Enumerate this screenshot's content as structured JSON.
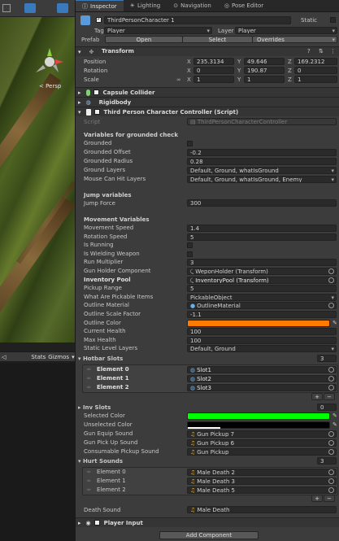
{
  "scene": {
    "stats": "Stats",
    "gizmos": "Gizmos",
    "persp": "< Persp"
  },
  "tabs": [
    "Inspector",
    "Lighting",
    "Navigation",
    "Pose Editor"
  ],
  "header": {
    "name": "ThirdPersonCharacter 1",
    "static": "Static",
    "tag_label": "Tag",
    "tag": "Player",
    "layer_label": "Layer",
    "layer": "Player",
    "prefab_label": "Prefab",
    "open": "Open",
    "select": "Select",
    "overrides": "Overrides"
  },
  "transform": {
    "title": "Transform",
    "position_label": "Position",
    "rotation_label": "Rotation",
    "scale_label": "Scale",
    "position": [
      "235.3134",
      "49.646",
      "169.2312"
    ],
    "rotation": [
      "0",
      "190.87",
      "0"
    ],
    "scale": [
      "1",
      "1",
      "1"
    ],
    "axes": [
      "X",
      "Y",
      "Z"
    ]
  },
  "components": {
    "capsule": "Capsule Collider",
    "rigidbody": "Rigidbody",
    "controller": "Third Person Character Controller (Script)",
    "player_input": "Player Input"
  },
  "script": {
    "label": "Script",
    "value": "ThirdPersonCharacterController"
  },
  "grounded": {
    "header": "Variables for grounded check",
    "rows": [
      {
        "label": "Grounded",
        "value": ""
      },
      {
        "label": "Grounded Offset",
        "value": "-0.2"
      },
      {
        "label": "Grounded Radius",
        "value": "0.28"
      },
      {
        "label": "Ground Layers",
        "value": "Default, Ground, whatIsGround"
      },
      {
        "label": "Mouse Can Hit Layers",
        "value": "Default, Ground, whatIsGround, Enemy"
      }
    ]
  },
  "jump": {
    "header": "Jump variables",
    "label": "Jump Force",
    "value": "300"
  },
  "movement": {
    "header": "Movement Variables",
    "rows": [
      {
        "label": "Movement Speed",
        "value": "1.4"
      },
      {
        "label": "Rotation Speed",
        "value": "5"
      },
      {
        "label": "Is Running",
        "value": ""
      },
      {
        "label": "Is Wielding Weapon",
        "value": ""
      },
      {
        "label": "Run Multiplier",
        "value": "3"
      },
      {
        "label": "Gun Holder Component",
        "value": "WeponHolder (Transform)"
      },
      {
        "label": "Inventory Pool",
        "value": "InventoryPool (Transform)"
      },
      {
        "label": "Pickup Range",
        "value": "5"
      },
      {
        "label": "What Are Pickable Items",
        "value": "PickableObject"
      },
      {
        "label": "Outline Material",
        "value": "OutlineMaterial"
      },
      {
        "label": "Outline Scale Factor",
        "value": "-1.1"
      },
      {
        "label": "Outline Color",
        "value": ""
      },
      {
        "label": "Current Health",
        "value": "100"
      },
      {
        "label": "Max Health",
        "value": "100"
      },
      {
        "label": "Static Level Layers",
        "value": "Default, Ground"
      }
    ]
  },
  "hotbar": {
    "label": "Hotbar Slots",
    "count": "3",
    "items": [
      {
        "label": "Element 0",
        "value": "Slot1"
      },
      {
        "label": "Element 1",
        "value": "Slot2"
      },
      {
        "label": "Element 2",
        "value": "Slot3"
      }
    ]
  },
  "inv": {
    "label": "Inv Slots",
    "count": "0"
  },
  "more": [
    {
      "label": "Selected Color",
      "value": ""
    },
    {
      "label": "Unselected Color",
      "value": ""
    },
    {
      "label": "Gun Equip Sound",
      "value": "Gun Pickup 7"
    },
    {
      "label": "Gun Pick Up Sound",
      "value": "Gun Pickup 6"
    },
    {
      "label": "Consumable Pickup Sound",
      "value": "Gun Pickup"
    }
  ],
  "hurt": {
    "label": "Hurt Sounds",
    "count": "3",
    "items": [
      {
        "label": "Element 0",
        "value": "Male Death 2"
      },
      {
        "label": "Element 1",
        "value": "Male Death 3"
      },
      {
        "label": "Element 2",
        "value": "Male Death 5"
      }
    ]
  },
  "death": {
    "label": "Death Sound",
    "value": "Male Death"
  },
  "add_component": "Add Component",
  "plus": "+",
  "minus": "−",
  "colors": {
    "outline": "#ff7a00",
    "selected": "#00ff00",
    "unselected": "#ffffff"
  }
}
